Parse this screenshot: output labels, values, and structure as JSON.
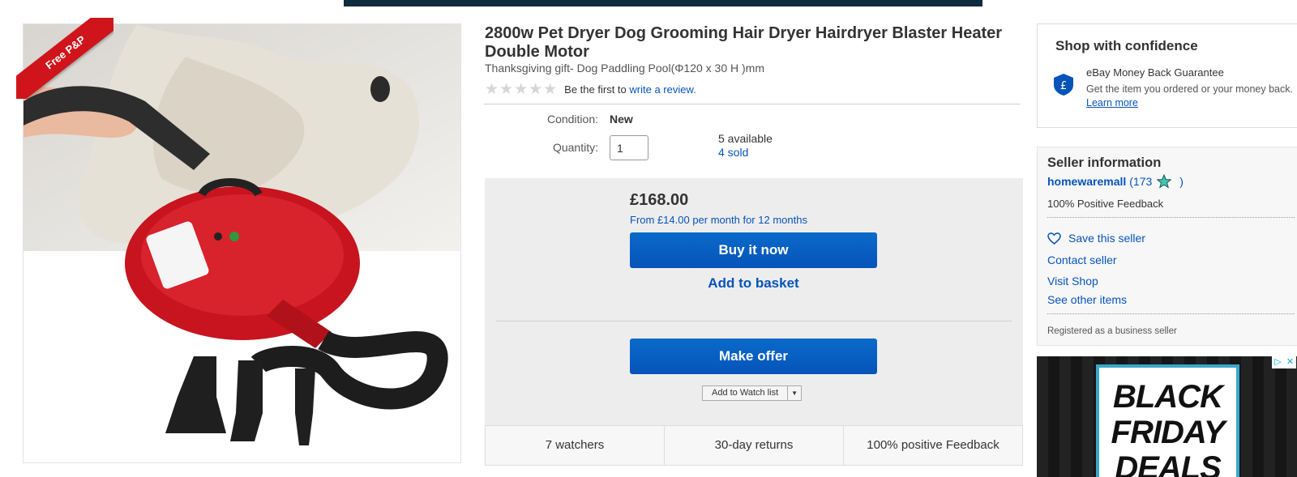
{
  "product": {
    "title": "2800w Pet Dryer Dog Grooming Hair Dryer Hairdryer Blaster Heater Double Motor",
    "subtitle": "Thanksgiving gift- Dog Paddling Pool(Φ120 x 30 H )mm",
    "rating_stars": 0,
    "rating_prompt": "Be the first to",
    "review_link": "write a review.",
    "image_badge": "Free P&P"
  },
  "details": {
    "condition_label": "Condition:",
    "condition_value": "New",
    "quantity_label": "Quantity:",
    "quantity_value": "1",
    "available": "5 available",
    "sold": "4 sold"
  },
  "purchase": {
    "price": "£168.00",
    "monthly": "From £14.00 per month for 12 months",
    "buy_now": "Buy it now",
    "add_basket": "Add to basket",
    "make_offer": "Make offer",
    "watch_list": "Add to Watch list"
  },
  "stats": [
    "7 watchers",
    "30-day returns",
    "100% positive Feedback"
  ],
  "confidence": {
    "title": "Shop with confidence",
    "guarantee_title": "eBay Money Back Guarantee",
    "guarantee_text": "Get the item you ordered or your money back.",
    "learn_more": "Learn more"
  },
  "seller": {
    "title": "Seller information",
    "name": "homewaremall",
    "score_open": "(173",
    "score_close": ")",
    "feedback": "100% Positive Feedback",
    "save": "Save this seller",
    "contact": "Contact seller",
    "visit": "Visit Shop",
    "other": "See other items",
    "registered": "Registered as a business seller"
  },
  "ad": {
    "line1": "BLACK",
    "line2": "FRIDAY",
    "line3": "DEALS"
  },
  "colors": {
    "link": "#0654ba",
    "button": "#0654ba",
    "badge": "#d0141c",
    "dryer": "#c8141f"
  }
}
